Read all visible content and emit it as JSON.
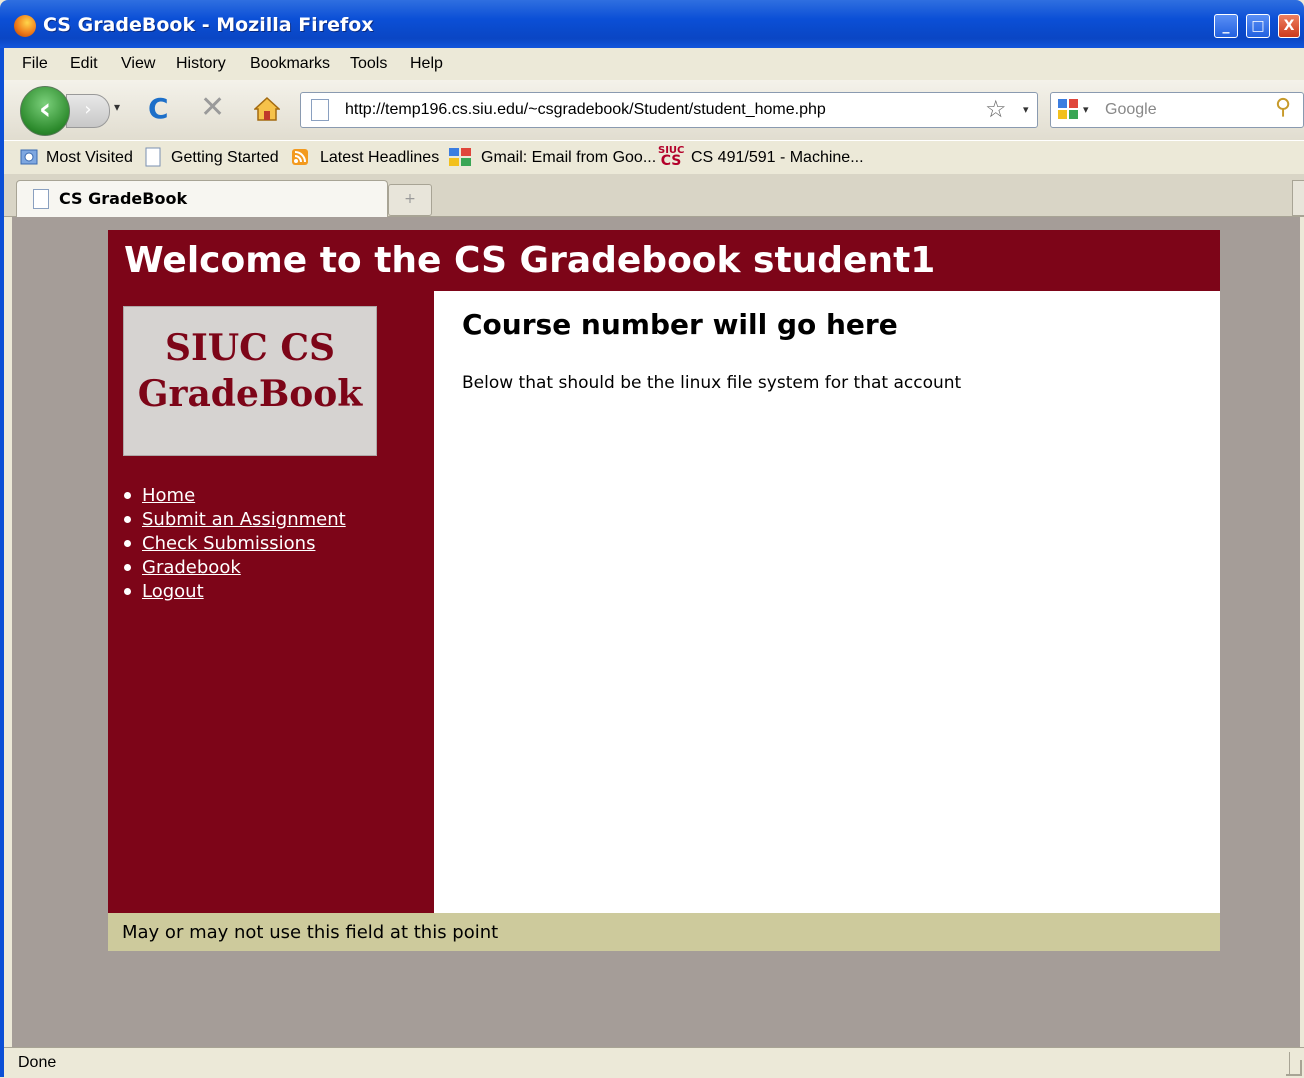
{
  "window": {
    "title": "CS GradeBook - Mozilla Firefox",
    "minimize_glyph": "_",
    "maximize_glyph": "□",
    "close_glyph": "X"
  },
  "menubar": {
    "items": [
      "File",
      "Edit",
      "View",
      "History",
      "Bookmarks",
      "Tools",
      "Help"
    ]
  },
  "navbar": {
    "back_glyph": "‹",
    "forward_glyph": "›",
    "history_dropdown_glyph": "▾",
    "reload_glyph": "C",
    "stop_glyph": "✕",
    "url": "http://temp196.cs.siu.edu/~csgradebook/Student/student_home.php",
    "star_glyph": "☆",
    "url_dropdown_glyph": "▾",
    "search_placeholder": "Google",
    "search_dropdown_glyph": "▾",
    "search_glyph": "⚲"
  },
  "bookmarks": {
    "items": [
      {
        "label": "Most Visited",
        "icon": "smart-folder-icon"
      },
      {
        "label": "Getting Started",
        "icon": "page-icon"
      },
      {
        "label": "Latest Headlines",
        "icon": "rss-icon"
      },
      {
        "label": "Gmail: Email from Goo...",
        "icon": "google-icon"
      },
      {
        "label": "CS 491/591 - Machine...",
        "icon": "siuc-cs-icon"
      }
    ],
    "siuc_icon_text_top": "SIUC",
    "siuc_icon_text_bottom": "CS"
  },
  "tabs": {
    "active_tab_label": "CS GradeBook",
    "new_tab_glyph": "+"
  },
  "page": {
    "header_title": "Welcome to the CS Gradebook student1",
    "logo_line1": "SIUC CS",
    "logo_line2": "GradeBook",
    "nav": [
      "Home",
      "Submit an Assignment",
      "Check Submissions",
      "Gradebook",
      "Logout"
    ],
    "main_heading": "Course number will go here",
    "main_text": "Below that should be the linux file system for that account",
    "footer_text": "May or may not use this field at this point"
  },
  "statusbar": {
    "text": "Done"
  },
  "colors": {
    "maroon": "#7d0518",
    "footer_tan": "#cdca9c",
    "page_bg": "#a59d98",
    "logo_bg": "#d6d3d1"
  }
}
